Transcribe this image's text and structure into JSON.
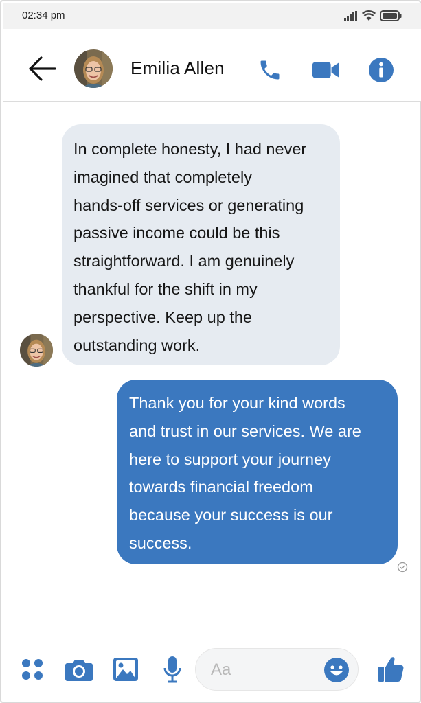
{
  "status_bar": {
    "time": "02:34 pm",
    "icons": [
      "signal-icon",
      "wifi-icon",
      "battery-icon"
    ]
  },
  "header": {
    "contact_name": "Emilia Allen",
    "icons": [
      "back-arrow-icon",
      "phone-icon",
      "video-camera-icon",
      "info-icon"
    ]
  },
  "messages": [
    {
      "direction": "incoming",
      "lines": [
        "In complete honesty, I had never",
        "imagined that completely",
        "hands-off services or generating",
        "passive income could be this",
        "straightforward. I am genuinely",
        "thankful for the shift in my",
        "perspective. Keep up the",
        "outstanding work."
      ]
    },
    {
      "direction": "outgoing",
      "lines": [
        "Thank you for your kind words",
        "and trust in our services. We are",
        "here to support your journey",
        "towards financial freedom",
        "because your success is our",
        "success."
      ]
    }
  ],
  "composer": {
    "placeholder": "Aa",
    "icons": [
      "apps-icon",
      "camera-icon",
      "image-icon",
      "microphone-icon",
      "emoji-icon",
      "thumbs-up-icon"
    ]
  },
  "colors": {
    "accent": "#3b78bf",
    "incoming_bubble": "#e6ebf1",
    "status_bar_bg": "#f2f2f2"
  }
}
